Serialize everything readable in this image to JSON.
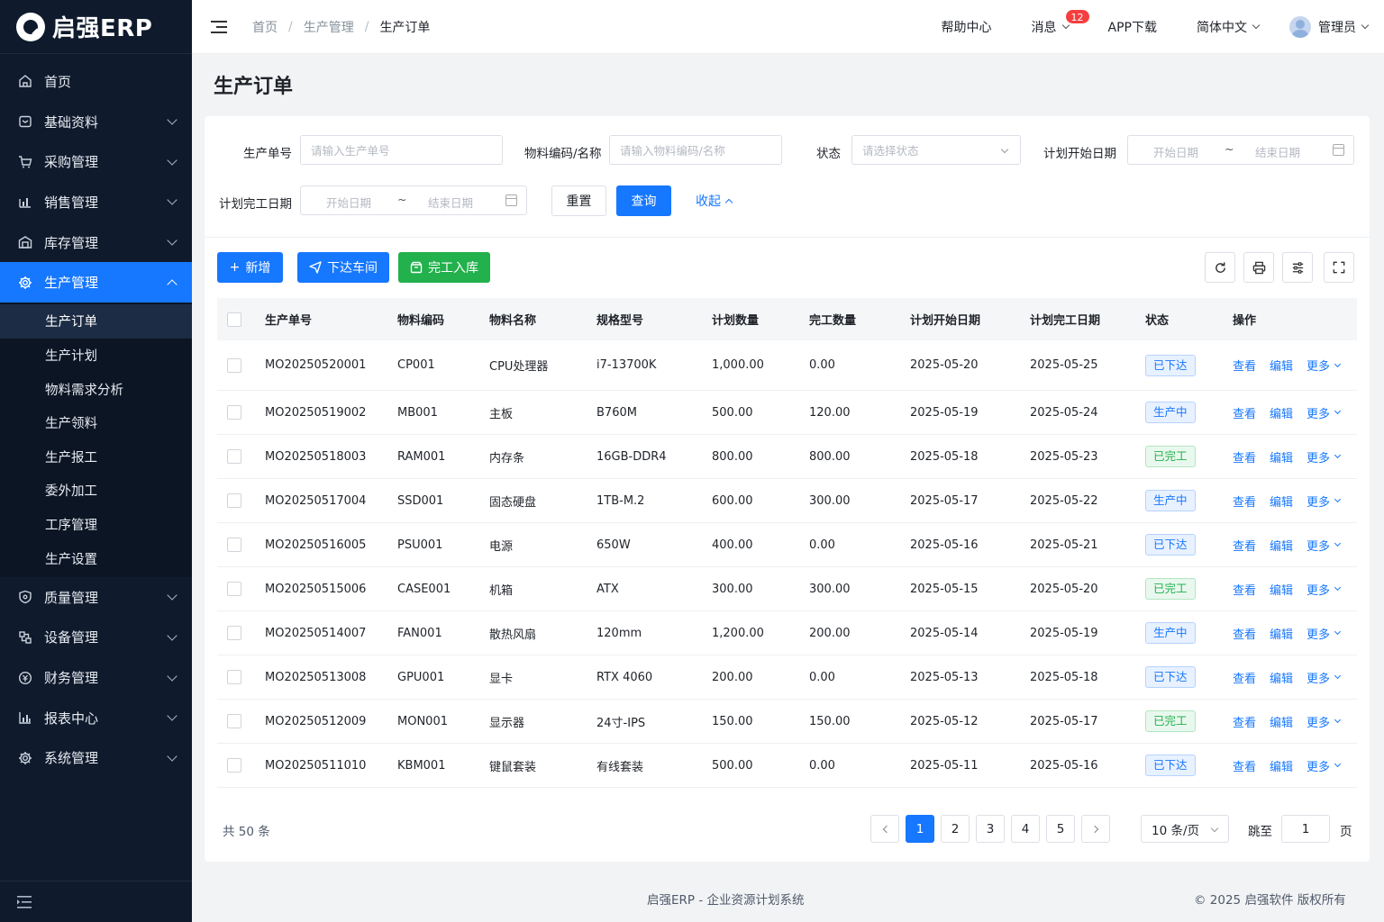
{
  "app": {
    "name": "启强ERP"
  },
  "sidebar": {
    "items": [
      {
        "label": "首页",
        "icon": "home-icon",
        "has_children": false
      },
      {
        "label": "基础资料",
        "icon": "database-icon",
        "has_children": true
      },
      {
        "label": "采购管理",
        "icon": "cart-icon",
        "has_children": true
      },
      {
        "label": "销售管理",
        "icon": "sales-icon",
        "has_children": true
      },
      {
        "label": "库存管理",
        "icon": "warehouse-icon",
        "has_children": true
      },
      {
        "label": "生产管理",
        "icon": "gear-icon",
        "has_children": true,
        "active": true
      },
      {
        "label": "质量管理",
        "icon": "shield-icon",
        "has_children": true
      },
      {
        "label": "设备管理",
        "icon": "device-icon",
        "has_children": true
      },
      {
        "label": "财务管理",
        "icon": "coin-icon",
        "has_children": true
      },
      {
        "label": "报表中心",
        "icon": "bar-chart-icon",
        "has_children": true
      },
      {
        "label": "系统管理",
        "icon": "settings-icon",
        "has_children": true
      }
    ],
    "submenu": [
      "生产订单",
      "生产计划",
      "物料需求分析",
      "生产领料",
      "生产报工",
      "委外加工",
      "工序管理",
      "生产设置"
    ],
    "submenu_active": "生产订单"
  },
  "header": {
    "breadcrumb": [
      "首页",
      "生产管理",
      "生产订单"
    ],
    "help": "帮助中心",
    "messages": "消息",
    "message_count": "12",
    "app_download": "APP下载",
    "language": "简体中文",
    "user": "管理员"
  },
  "page": {
    "title": "生产订单"
  },
  "filters": {
    "order_no_label": "生产单号",
    "order_no_placeholder": "请输入生产单号",
    "material_label": "物料编码/名称",
    "material_placeholder": "请输入物料编码/名称",
    "status_label": "状态",
    "status_placeholder": "请选择状态",
    "plan_start_label": "计划开始日期",
    "plan_end_label": "计划完工日期",
    "date_start_placeholder": "开始日期",
    "date_end_placeholder": "结束日期",
    "date_sep": "~",
    "reset": "重置",
    "search": "查询",
    "collapse": "收起"
  },
  "toolbar": {
    "add": "新增",
    "dispatch": "下达车间",
    "complete": "完工入库"
  },
  "table": {
    "columns": [
      "生产单号",
      "物料编码",
      "物料名称",
      "规格型号",
      "计划数量",
      "完工数量",
      "计划开始日期",
      "计划完工日期",
      "状态",
      "操作"
    ],
    "ops": {
      "view": "查看",
      "edit": "编辑",
      "more": "更多"
    },
    "rows": [
      {
        "no": "MO20250520001",
        "code": "CP001",
        "name": "CPU处理器",
        "spec": "i7-13700K",
        "plan": "1,000.00",
        "done": "0.00",
        "start": "2025-05-20",
        "end": "2025-05-25",
        "status": "已下达",
        "status_color": "blue"
      },
      {
        "no": "MO20250519002",
        "code": "MB001",
        "name": "主板",
        "spec": "B760M",
        "plan": "500.00",
        "done": "120.00",
        "start": "2025-05-19",
        "end": "2025-05-24",
        "status": "生产中",
        "status_color": "blue"
      },
      {
        "no": "MO20250518003",
        "code": "RAM001",
        "name": "内存条",
        "spec": "16GB-DDR4",
        "plan": "800.00",
        "done": "800.00",
        "start": "2025-05-18",
        "end": "2025-05-23",
        "status": "已完工",
        "status_color": "green"
      },
      {
        "no": "MO20250517004",
        "code": "SSD001",
        "name": "固态硬盘",
        "spec": "1TB-M.2",
        "plan": "600.00",
        "done": "300.00",
        "start": "2025-05-17",
        "end": "2025-05-22",
        "status": "生产中",
        "status_color": "blue"
      },
      {
        "no": "MO20250516005",
        "code": "PSU001",
        "name": "电源",
        "spec": "650W",
        "plan": "400.00",
        "done": "0.00",
        "start": "2025-05-16",
        "end": "2025-05-21",
        "status": "已下达",
        "status_color": "blue"
      },
      {
        "no": "MO20250515006",
        "code": "CASE001",
        "name": "机箱",
        "spec": "ATX",
        "plan": "300.00",
        "done": "300.00",
        "start": "2025-05-15",
        "end": "2025-05-20",
        "status": "已完工",
        "status_color": "green"
      },
      {
        "no": "MO20250514007",
        "code": "FAN001",
        "name": "散热风扇",
        "spec": "120mm",
        "plan": "1,200.00",
        "done": "200.00",
        "start": "2025-05-14",
        "end": "2025-05-19",
        "status": "生产中",
        "status_color": "blue"
      },
      {
        "no": "MO20250513008",
        "code": "GPU001",
        "name": "显卡",
        "spec": "RTX 4060",
        "plan": "200.00",
        "done": "0.00",
        "start": "2025-05-13",
        "end": "2025-05-18",
        "status": "已下达",
        "status_color": "blue"
      },
      {
        "no": "MO20250512009",
        "code": "MON001",
        "name": "显示器",
        "spec": "24寸-IPS",
        "plan": "150.00",
        "done": "150.00",
        "start": "2025-05-12",
        "end": "2025-05-17",
        "status": "已完工",
        "status_color": "green"
      },
      {
        "no": "MO20250511010",
        "code": "KBM001",
        "name": "键鼠套装",
        "spec": "有线套装",
        "plan": "500.00",
        "done": "0.00",
        "start": "2025-05-11",
        "end": "2025-05-16",
        "status": "已下达",
        "status_color": "blue"
      }
    ]
  },
  "pagination": {
    "total": "共 50 条",
    "pages": [
      "1",
      "2",
      "3",
      "4",
      "5"
    ],
    "current": "1",
    "page_size": "10 条/页",
    "jump_label": "跳至",
    "jump_value": "1",
    "page_unit": "页"
  },
  "footer": {
    "left": "启强ERP - 企业资源计划系统",
    "right": "© 2025 启强软件 版权所有"
  },
  "colors": {
    "primary": "#1677ff",
    "success": "#22b14c",
    "sidebar": "#0f1b2d"
  }
}
